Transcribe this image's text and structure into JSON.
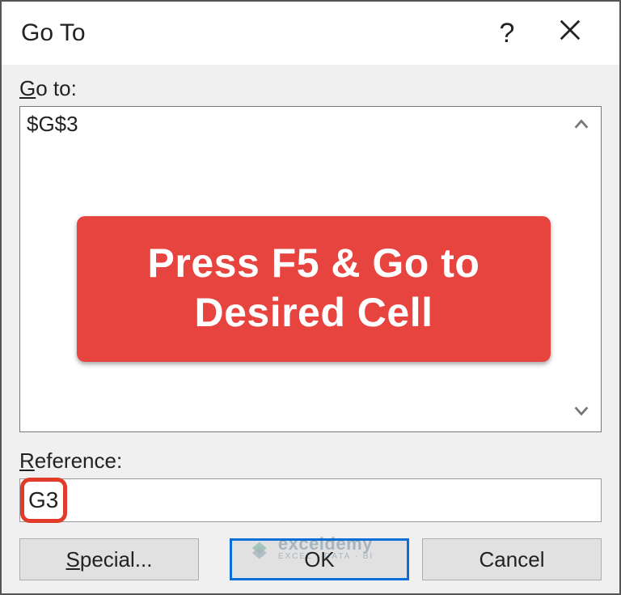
{
  "dialog": {
    "title": "Go To",
    "help_symbol": "?"
  },
  "goto": {
    "label_prefix": "G",
    "label_rest": "o to:",
    "items": [
      "$G$3"
    ]
  },
  "reference": {
    "label_prefix": "R",
    "label_rest": "eference:",
    "value": "G3"
  },
  "buttons": {
    "special_prefix": "S",
    "special_rest": "pecial...",
    "ok": "OK",
    "cancel": "Cancel"
  },
  "overlay": {
    "text": "Press F5 & Go to Desired Cell"
  },
  "watermark": {
    "brand": "exceldemy",
    "tag": "EXCEL · DATA · BI"
  }
}
